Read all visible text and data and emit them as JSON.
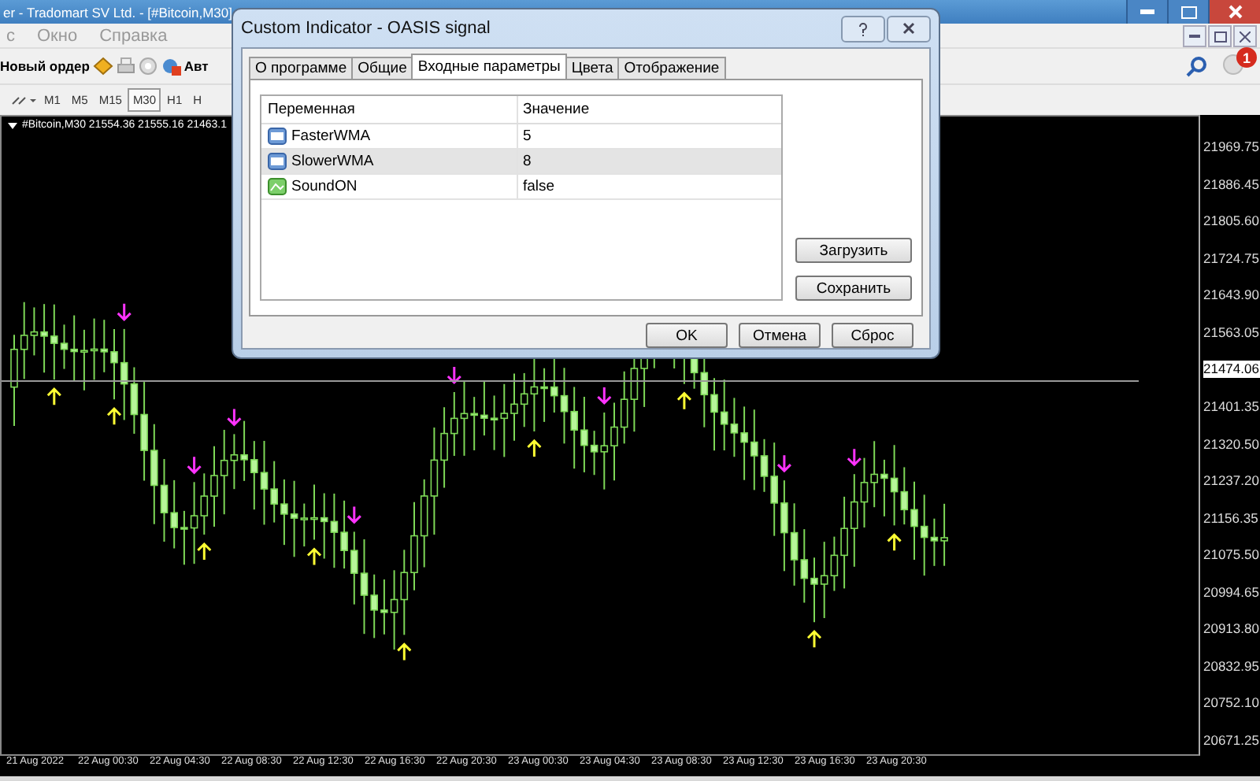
{
  "app_window": {
    "title": "er - Tradomart SV Ltd. - [#Bitcoin,M30]"
  },
  "menu": [
    "с",
    "Окно",
    "Справка"
  ],
  "toolbar": {
    "new_order": "Новый ордер",
    "auto_trading": "Авт",
    "notification_count": "1"
  },
  "timeframes": [
    {
      "label": "M1",
      "selected": false
    },
    {
      "label": "M5",
      "selected": false
    },
    {
      "label": "M15",
      "selected": false
    },
    {
      "label": "M30",
      "selected": true
    },
    {
      "label": "H1",
      "selected": false
    },
    {
      "label": "H",
      "selected": false
    }
  ],
  "chart": {
    "symbol_info": "#Bitcoin,M30  21554.36 21555.16 21463.1",
    "price_axis": [
      "21969.75",
      "21886.45",
      "21805.60",
      "21724.75",
      "21643.90",
      "21563.05",
      "21401.35",
      "21320.50",
      "21237.20",
      "21156.35",
      "21075.50",
      "20994.65",
      "20913.80",
      "20832.95",
      "20752.10",
      "20671.25"
    ],
    "current_price": "21474.06",
    "time_axis": [
      "21 Aug 2022",
      "22 Aug 00:30",
      "22 Aug 04:30",
      "22 Aug 08:30",
      "22 Aug 12:30",
      "22 Aug 16:30",
      "22 Aug 20:30",
      "23 Aug 00:30",
      "23 Aug 04:30",
      "23 Aug 08:30",
      "23 Aug 12:30",
      "23 Aug 16:30",
      "23 Aug 20:30"
    ]
  },
  "dialog": {
    "title": "Custom Indicator - OASIS signal",
    "tabs": [
      {
        "label": "О программе",
        "selected": false
      },
      {
        "label": "Общие",
        "selected": false
      },
      {
        "label": "Входные параметры",
        "selected": true
      },
      {
        "label": "Цвета",
        "selected": false
      },
      {
        "label": "Отображение",
        "selected": false
      }
    ],
    "columns": [
      "Переменная",
      "Значение"
    ],
    "rows": [
      {
        "kind": "int",
        "variable": "FasterWMA",
        "value": "5",
        "selected": false
      },
      {
        "kind": "int",
        "variable": "SlowerWMA",
        "value": "8",
        "selected": true
      },
      {
        "kind": "bool",
        "variable": "SoundON",
        "value": "false",
        "selected": false
      }
    ],
    "side_buttons": [
      "Загрузить",
      "Сохранить"
    ],
    "buttons": [
      "OK",
      "Отмена",
      "Сброс"
    ]
  }
}
